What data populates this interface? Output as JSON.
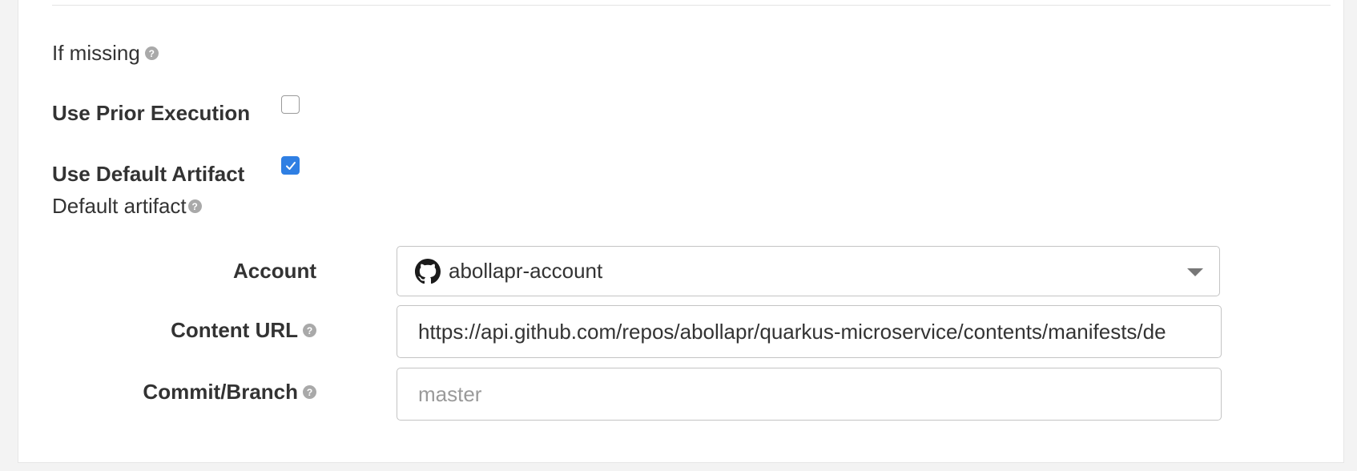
{
  "form": {
    "if_missing_label": "If missing",
    "use_prior_execution": {
      "label": "Use Prior Execution",
      "checked": false
    },
    "use_default_artifact": {
      "label": "Use Default Artifact",
      "checked": true
    },
    "default_artifact_label": "Default artifact",
    "account": {
      "label": "Account",
      "value": "abollapr-account",
      "icon": "github-icon"
    },
    "content_url": {
      "label": "Content URL",
      "value": "https://api.github.com/repos/abollapr/quarkus-microservice/contents/manifests/de"
    },
    "commit_branch": {
      "label": "Commit/Branch",
      "placeholder": "master",
      "value": ""
    }
  },
  "colors": {
    "checkbox_checked": "#2f7fe3",
    "help_icon": "#a9a9a9",
    "input_border": "#c4c4c4"
  }
}
